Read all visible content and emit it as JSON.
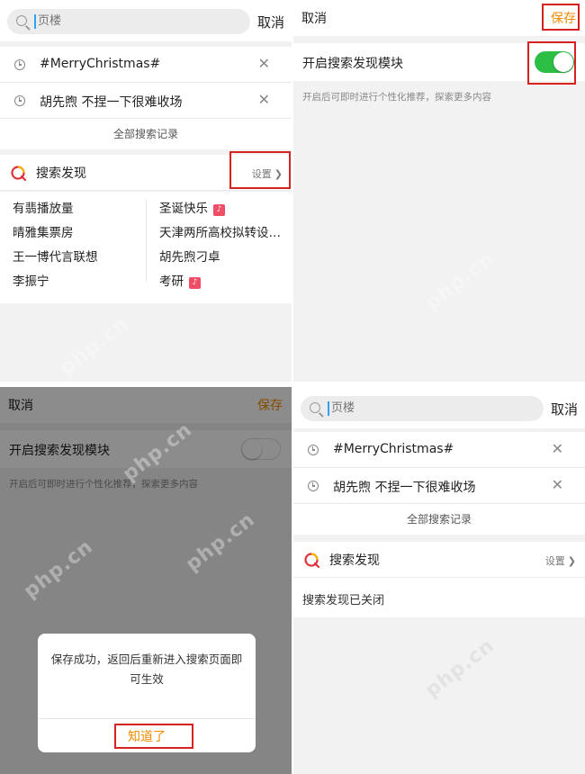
{
  "colors": {
    "accent": "#f08a00",
    "toggle_on": "#2dbe46",
    "highlight": "#d7231f",
    "hot_badge": "#f04d67",
    "link_blue": "#2ea3ee"
  },
  "search": {
    "placeholder": "页楼",
    "cancel_label": "取消",
    "history": [
      "#MerryChristmas#",
      "胡先煦 不捏一下很难收场"
    ],
    "all_history_label": "全部搜索记录"
  },
  "discover": {
    "title": "搜索发现",
    "settings_label": "设置",
    "left_items": [
      "有翡播放量",
      "晴雅集票房",
      "王一博代言联想",
      "李振宁"
    ],
    "right_items": [
      {
        "text": "圣诞快乐",
        "hot": true
      },
      {
        "text": "天津两所高校拟转设…",
        "hot": false
      },
      {
        "text": "胡先煦刁卓",
        "hot": false
      },
      {
        "text": "考研",
        "hot": true
      }
    ],
    "hot_badge_label": "♪",
    "closed_label": "搜索发现已关闭"
  },
  "settings": {
    "cancel_label": "取消",
    "save_label": "保存",
    "toggle_label": "开启搜索发现模块",
    "toggle_note": "开启后可即时进行个性化推荐，探索更多内容",
    "toggle_on": true,
    "toggle_off": false
  },
  "dialog": {
    "message": "保存成功，返回后重新进入搜索页面即可生效",
    "confirm_label": "知道了"
  },
  "watermark_text": "php.cn"
}
